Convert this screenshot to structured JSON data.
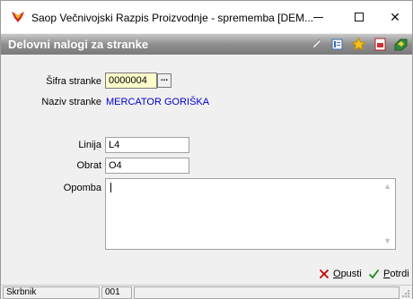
{
  "window": {
    "title": "Saop  Večnivojski Razpis Proizvodnje - sprememba [DEM...",
    "minimize_symbol": "—",
    "close_symbol": "✕"
  },
  "header": {
    "title": "Delovni nalogi za stranke",
    "icons": [
      "edit-icon",
      "form-icon",
      "star-icon",
      "pdf-icon",
      "export-icon"
    ]
  },
  "form": {
    "sifra_label": "Šifra stranke",
    "sifra_value": "0000004",
    "lookup_label": "...",
    "naziv_label": "Naziv stranke",
    "naziv_value": "MERCATOR GORIŠKA",
    "linija_label": "Linija",
    "linija_value": "L4",
    "obrat_label": "Obrat",
    "obrat_value": "O4",
    "opomba_label": "Opomba",
    "opomba_value": ""
  },
  "actions": {
    "cancel_label": "Opusti",
    "cancel_mnemonic": "O",
    "cancel_rest": "pusti",
    "confirm_label": "Potrdi",
    "confirm_mnemonic": "P",
    "confirm_rest": "otrdi"
  },
  "status": {
    "user": "Skrbnik",
    "code": "001"
  },
  "colors": {
    "link": "#0000cc",
    "yellow_field": "#ffffcc",
    "cancel_red": "#cc0000",
    "confirm_green": "#1a8a1a"
  }
}
